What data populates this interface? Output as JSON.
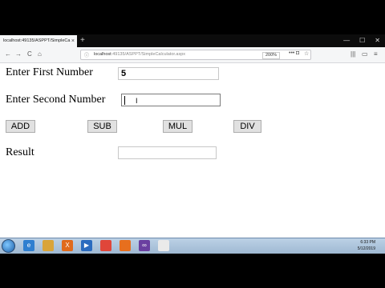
{
  "browser": {
    "tab_title": "localhost:49135/ASPPT/SimpleCa",
    "tab_close": "×",
    "new_tab": "+",
    "window_controls": [
      "—",
      "☐",
      "✕"
    ],
    "nav": {
      "back": "←",
      "forward": "→",
      "reload": "C",
      "home": "⌂"
    },
    "url": {
      "host": "localhost",
      "path": ":49135/ASPPT/SimpleCalculator.aspx"
    },
    "zoom": "200%",
    "more": "•••",
    "tools": [
      "|||",
      "▭",
      "≡"
    ]
  },
  "form": {
    "first_label": "Enter First Number",
    "first_value": "5",
    "second_label": "Enter Second Number",
    "second_value": "",
    "result_label": "Result",
    "result_value": "",
    "buttons": {
      "add": "ADD",
      "sub": "SUB",
      "mul": "MUL",
      "div": "DIV"
    }
  },
  "taskbar": {
    "apps": [
      {
        "name": "internet-explorer-icon",
        "glyph": "e",
        "color": "#2f7fd0"
      },
      {
        "name": "file-explorer-icon",
        "glyph": "",
        "color": "#d9a43a"
      },
      {
        "name": "xampp-icon",
        "glyph": "X",
        "color": "#e06a1c"
      },
      {
        "name": "media-player-icon",
        "glyph": "▶",
        "color": "#2a6bbf"
      },
      {
        "name": "chrome-icon",
        "glyph": "",
        "color": "#e0463a"
      },
      {
        "name": "firefox-icon",
        "glyph": "",
        "color": "#e76f1e"
      },
      {
        "name": "visual-studio-icon",
        "glyph": "∞",
        "color": "#6a3fa0"
      },
      {
        "name": "notes-icon",
        "glyph": "",
        "color": "#eaeaea"
      }
    ],
    "time": "6:33 PM",
    "date": "5/12/2019"
  }
}
